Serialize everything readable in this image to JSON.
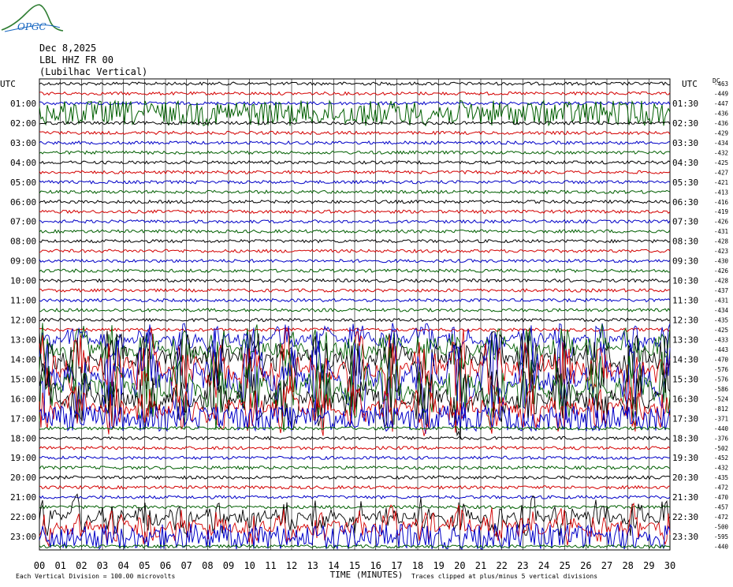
{
  "header": {
    "logo_text": "OPGC",
    "date": "Dec 8,2025",
    "station": "LBL HHZ FR 00",
    "location": "(Lubilhac Vertical)"
  },
  "labels": {
    "left_utc": "UTC",
    "right_utc": "UTC",
    "right_dc": "DC"
  },
  "chart_data": {
    "type": "line",
    "title": "Dec 8,2025 LBL HHZ FR 00 (Lubilhac Vertical)",
    "xlabel": "TIME (MINUTES)",
    "xlim": [
      0,
      30
    ],
    "x_ticks": [
      "00",
      "01",
      "02",
      "03",
      "04",
      "05",
      "06",
      "07",
      "08",
      "09",
      "10",
      "11",
      "12",
      "13",
      "14",
      "15",
      "16",
      "17",
      "18",
      "19",
      "20",
      "21",
      "22",
      "23",
      "24",
      "25",
      "26",
      "27",
      "28",
      "29",
      "30"
    ],
    "left_hour_labels": [
      "01:00",
      "02:00",
      "03:00",
      "04:00",
      "05:00",
      "06:00",
      "07:00",
      "08:00",
      "09:00",
      "10:00",
      "11:00",
      "12:00",
      "13:00",
      "14:00",
      "15:00",
      "16:00",
      "17:00",
      "18:00",
      "19:00",
      "20:00",
      "21:00",
      "22:00",
      "23:00"
    ],
    "right_hour_labels": [
      "01:30",
      "02:30",
      "03:30",
      "04:30",
      "05:30",
      "06:30",
      "07:30",
      "08:30",
      "09:30",
      "10:30",
      "11:30",
      "12:30",
      "13:30",
      "14:30",
      "15:30",
      "16:30",
      "17:30",
      "18:30",
      "19:30",
      "20:30",
      "21:30",
      "22:30",
      "23:30"
    ],
    "trace_colors": [
      "#000000",
      "#d40000",
      "#0000c8",
      "#005f00"
    ],
    "dc_offsets": [
      "-463",
      "-449",
      "-447",
      "-436",
      "-436",
      "-429",
      "-434",
      "-432",
      "-425",
      "-427",
      "-421",
      "-413",
      "-416",
      "-419",
      "-426",
      "-431",
      "-428",
      "-423",
      "-430",
      "-426",
      "-428",
      "-437",
      "-431",
      "-434",
      "-435",
      "-425",
      "-433",
      "-443",
      "-470",
      "-576",
      "-576",
      "-586",
      "-524",
      "-812",
      "-371",
      "-440",
      "-376",
      "-502",
      "-452",
      "-432",
      "-435",
      "-472",
      "-470",
      "-457",
      "-472",
      "-500",
      "-595",
      "-440"
    ],
    "activity_level": [
      1,
      1,
      1,
      2,
      1,
      1,
      1,
      1,
      1,
      1,
      1,
      1,
      1,
      1,
      1,
      1,
      1,
      1,
      1,
      1,
      1,
      1,
      1,
      1,
      1,
      1,
      3,
      4,
      5,
      6,
      7,
      6,
      5,
      4,
      2,
      1,
      1,
      1,
      1,
      1,
      1,
      1,
      1,
      1,
      3,
      3,
      2,
      1
    ],
    "trace_count": 48,
    "footer_left": "Each Vertical Division =  100.00 microvolts",
    "footer_right": "Traces clipped at plus/minus 5 vertical divisions"
  }
}
